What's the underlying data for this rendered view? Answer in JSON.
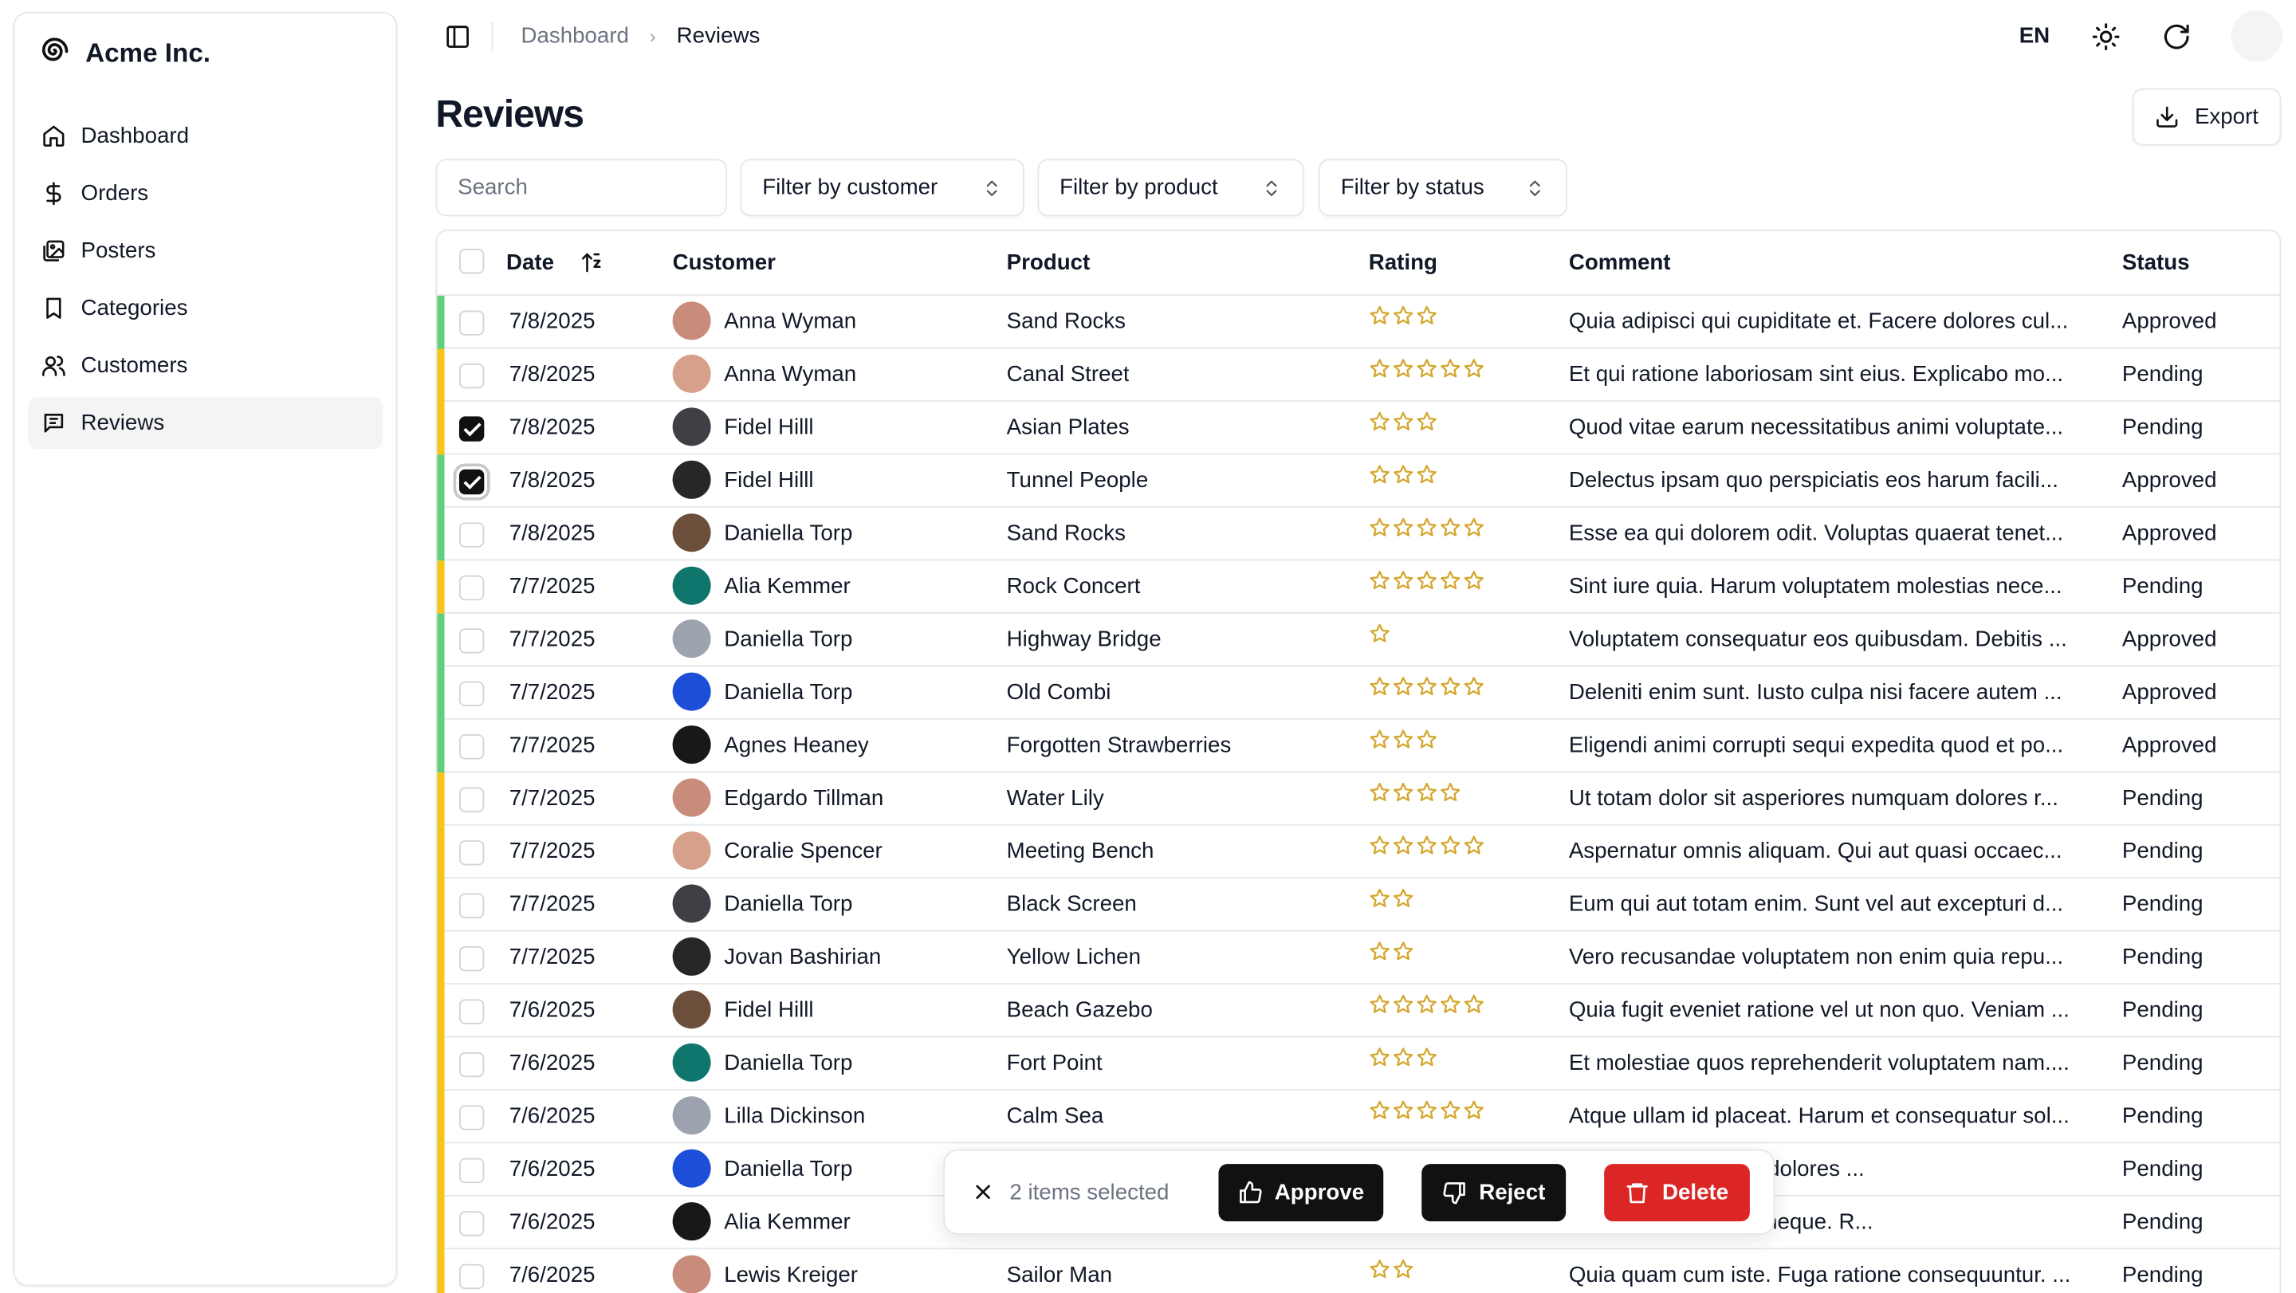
{
  "brand": {
    "name": "Acme Inc."
  },
  "sidebar": {
    "items": [
      {
        "label": "Dashboard",
        "icon": "home-icon",
        "active": false
      },
      {
        "label": "Orders",
        "icon": "dollar-icon",
        "active": false
      },
      {
        "label": "Posters",
        "icon": "images-icon",
        "active": false
      },
      {
        "label": "Categories",
        "icon": "bookmark-icon",
        "active": false
      },
      {
        "label": "Customers",
        "icon": "users-icon",
        "active": false
      },
      {
        "label": "Reviews",
        "icon": "message-icon",
        "active": true
      }
    ]
  },
  "topbar": {
    "breadcrumb": [
      "Dashboard",
      "Reviews"
    ],
    "language": "EN"
  },
  "page": {
    "title": "Reviews",
    "export_label": "Export"
  },
  "filters": {
    "search_placeholder": "Search",
    "customer": "Filter by customer",
    "product": "Filter by product",
    "status": "Filter by status"
  },
  "table": {
    "columns": [
      "Date",
      "Customer",
      "Product",
      "Rating",
      "Comment",
      "Status"
    ],
    "rows": [
      {
        "date": "7/8/2025",
        "customer": "Anna Wyman",
        "product": "Sand Rocks",
        "rating": 3,
        "comment": "Quia adipisci qui cupiditate et. Facere dolores cul...",
        "status": "Approved",
        "checked": false
      },
      {
        "date": "7/8/2025",
        "customer": "Anna Wyman",
        "product": "Canal Street",
        "rating": 5,
        "comment": "Et qui ratione laboriosam sint eius. Explicabo mo...",
        "status": "Pending",
        "checked": false
      },
      {
        "date": "7/8/2025",
        "customer": "Fidel Hilll",
        "product": "Asian Plates",
        "rating": 3,
        "comment": "Quod vitae earum necessitatibus animi voluptate...",
        "status": "Pending",
        "checked": true
      },
      {
        "date": "7/8/2025",
        "customer": "Fidel Hilll",
        "product": "Tunnel People",
        "rating": 3,
        "comment": "Delectus ipsam quo perspiciatis eos harum facili...",
        "status": "Approved",
        "checked": true
      },
      {
        "date": "7/8/2025",
        "customer": "Daniella Torp",
        "product": "Sand Rocks",
        "rating": 5,
        "comment": "Esse ea qui dolorem odit. Voluptas quaerat tenet...",
        "status": "Approved",
        "checked": false
      },
      {
        "date": "7/7/2025",
        "customer": "Alia Kemmer",
        "product": "Rock Concert",
        "rating": 5,
        "comment": "Sint iure quia. Harum voluptatem molestias nece...",
        "status": "Pending",
        "checked": false
      },
      {
        "date": "7/7/2025",
        "customer": "Daniella Torp",
        "product": "Highway Bridge",
        "rating": 1,
        "comment": "Voluptatem consequatur eos quibusdam. Debitis ...",
        "status": "Approved",
        "checked": false
      },
      {
        "date": "7/7/2025",
        "customer": "Daniella Torp",
        "product": "Old Combi",
        "rating": 5,
        "comment": "Deleniti enim sunt. Iusto culpa nisi facere autem ...",
        "status": "Approved",
        "checked": false
      },
      {
        "date": "7/7/2025",
        "customer": "Agnes Heaney",
        "product": "Forgotten Strawberries",
        "rating": 3,
        "comment": "Eligendi animi corrupti sequi expedita quod et po...",
        "status": "Approved",
        "checked": false
      },
      {
        "date": "7/7/2025",
        "customer": "Edgardo Tillman",
        "product": "Water Lily",
        "rating": 4,
        "comment": "Ut totam dolor sit asperiores numquam dolores r...",
        "status": "Pending",
        "checked": false
      },
      {
        "date": "7/7/2025",
        "customer": "Coralie Spencer",
        "product": "Meeting Bench",
        "rating": 5,
        "comment": "Aspernatur omnis aliquam. Qui aut quasi occaec...",
        "status": "Pending",
        "checked": false
      },
      {
        "date": "7/7/2025",
        "customer": "Daniella Torp",
        "product": "Black Screen",
        "rating": 2,
        "comment": "Eum qui aut totam enim. Sunt vel aut excepturi d...",
        "status": "Pending",
        "checked": false
      },
      {
        "date": "7/7/2025",
        "customer": "Jovan Bashirian",
        "product": "Yellow Lichen",
        "rating": 2,
        "comment": "Vero recusandae voluptatem non enim quia repu...",
        "status": "Pending",
        "checked": false
      },
      {
        "date": "7/6/2025",
        "customer": "Fidel Hilll",
        "product": "Beach Gazebo",
        "rating": 5,
        "comment": "Quia fugit eveniet ratione vel ut non quo. Veniam ...",
        "status": "Pending",
        "checked": false
      },
      {
        "date": "7/6/2025",
        "customer": "Daniella Torp",
        "product": "Fort Point",
        "rating": 3,
        "comment": "Et molestiae quos reprehenderit voluptatem nam....",
        "status": "Pending",
        "checked": false
      },
      {
        "date": "7/6/2025",
        "customer": "Lilla Dickinson",
        "product": "Calm Sea",
        "rating": 5,
        "comment": "Atque ullam id placeat. Harum et consequatur sol...",
        "status": "Pending",
        "checked": false
      },
      {
        "date": "7/6/2025",
        "customer": "Daniella Torp",
        "product": "",
        "rating": 0,
        "comment": "possimus eos porro dolores ...",
        "status": "Pending",
        "checked": false
      },
      {
        "date": "7/6/2025",
        "customer": "Alia Kemmer",
        "product": "",
        "rating": 0,
        "comment": "Perferendis error et neque. R...",
        "status": "Pending",
        "checked": false
      },
      {
        "date": "7/6/2025",
        "customer": "Lewis Kreiger",
        "product": "Sailor Man",
        "rating": 2,
        "comment": "Quia quam cum iste. Fuga ratione consequuntur. ...",
        "status": "Pending",
        "checked": false
      }
    ]
  },
  "bulk": {
    "count_text": "2 items selected",
    "approve": "Approve",
    "reject": "Reject",
    "delete": "Delete"
  },
  "colors": {
    "approved": "#5fd07b",
    "pending": "#f5c518",
    "star": "#d4a72c",
    "delete": "#dc2626",
    "dark_button": "#111111"
  }
}
